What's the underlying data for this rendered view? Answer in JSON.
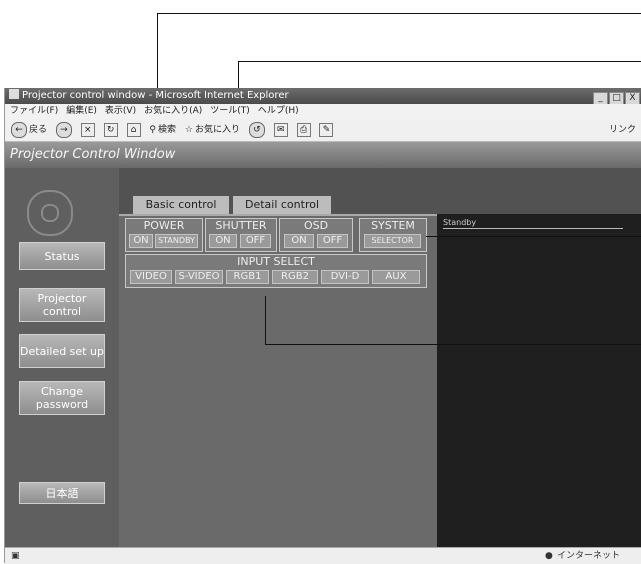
{
  "window": {
    "title": "Projector control window - Microsoft Internet Explorer",
    "controls": [
      "_",
      "□",
      "X"
    ]
  },
  "menu": [
    "ファイル(F)",
    "編集(E)",
    "表示(V)",
    "お気に入り(A)",
    "ツール(T)",
    "ヘルプ(H)"
  ],
  "toolbar": {
    "back_label": "戻る",
    "search_label": "検索",
    "favorites_label": "お気に入り",
    "links_label": "リンク"
  },
  "app": {
    "header_title": "Projector Control Window",
    "nav": {
      "status": "Status",
      "projector_control": "Projector control",
      "detailed_setup": "Detailed set up",
      "change_password": "Change password",
      "language": "日本語"
    },
    "tabs": {
      "basic": "Basic control",
      "detail": "Detail control"
    },
    "power": {
      "title": "POWER",
      "on": "ON",
      "standby": "STANDBY"
    },
    "shutter": {
      "title": "SHUTTER",
      "on": "ON",
      "off": "OFF"
    },
    "osd": {
      "title": "OSD",
      "on": "ON",
      "off": "OFF"
    },
    "system": {
      "title": "SYSTEM",
      "selector": "SELECTOR"
    },
    "input_select": {
      "title": "INPUT SELECT",
      "video": "VIDEO",
      "svideo": "S-VIDEO",
      "rgb1": "RGB1",
      "rgb2": "RGB2",
      "dvid": "DVI-D",
      "aux": "AUX"
    },
    "status_text": "Standby"
  },
  "statusbar": {
    "zone": "インターネット"
  }
}
